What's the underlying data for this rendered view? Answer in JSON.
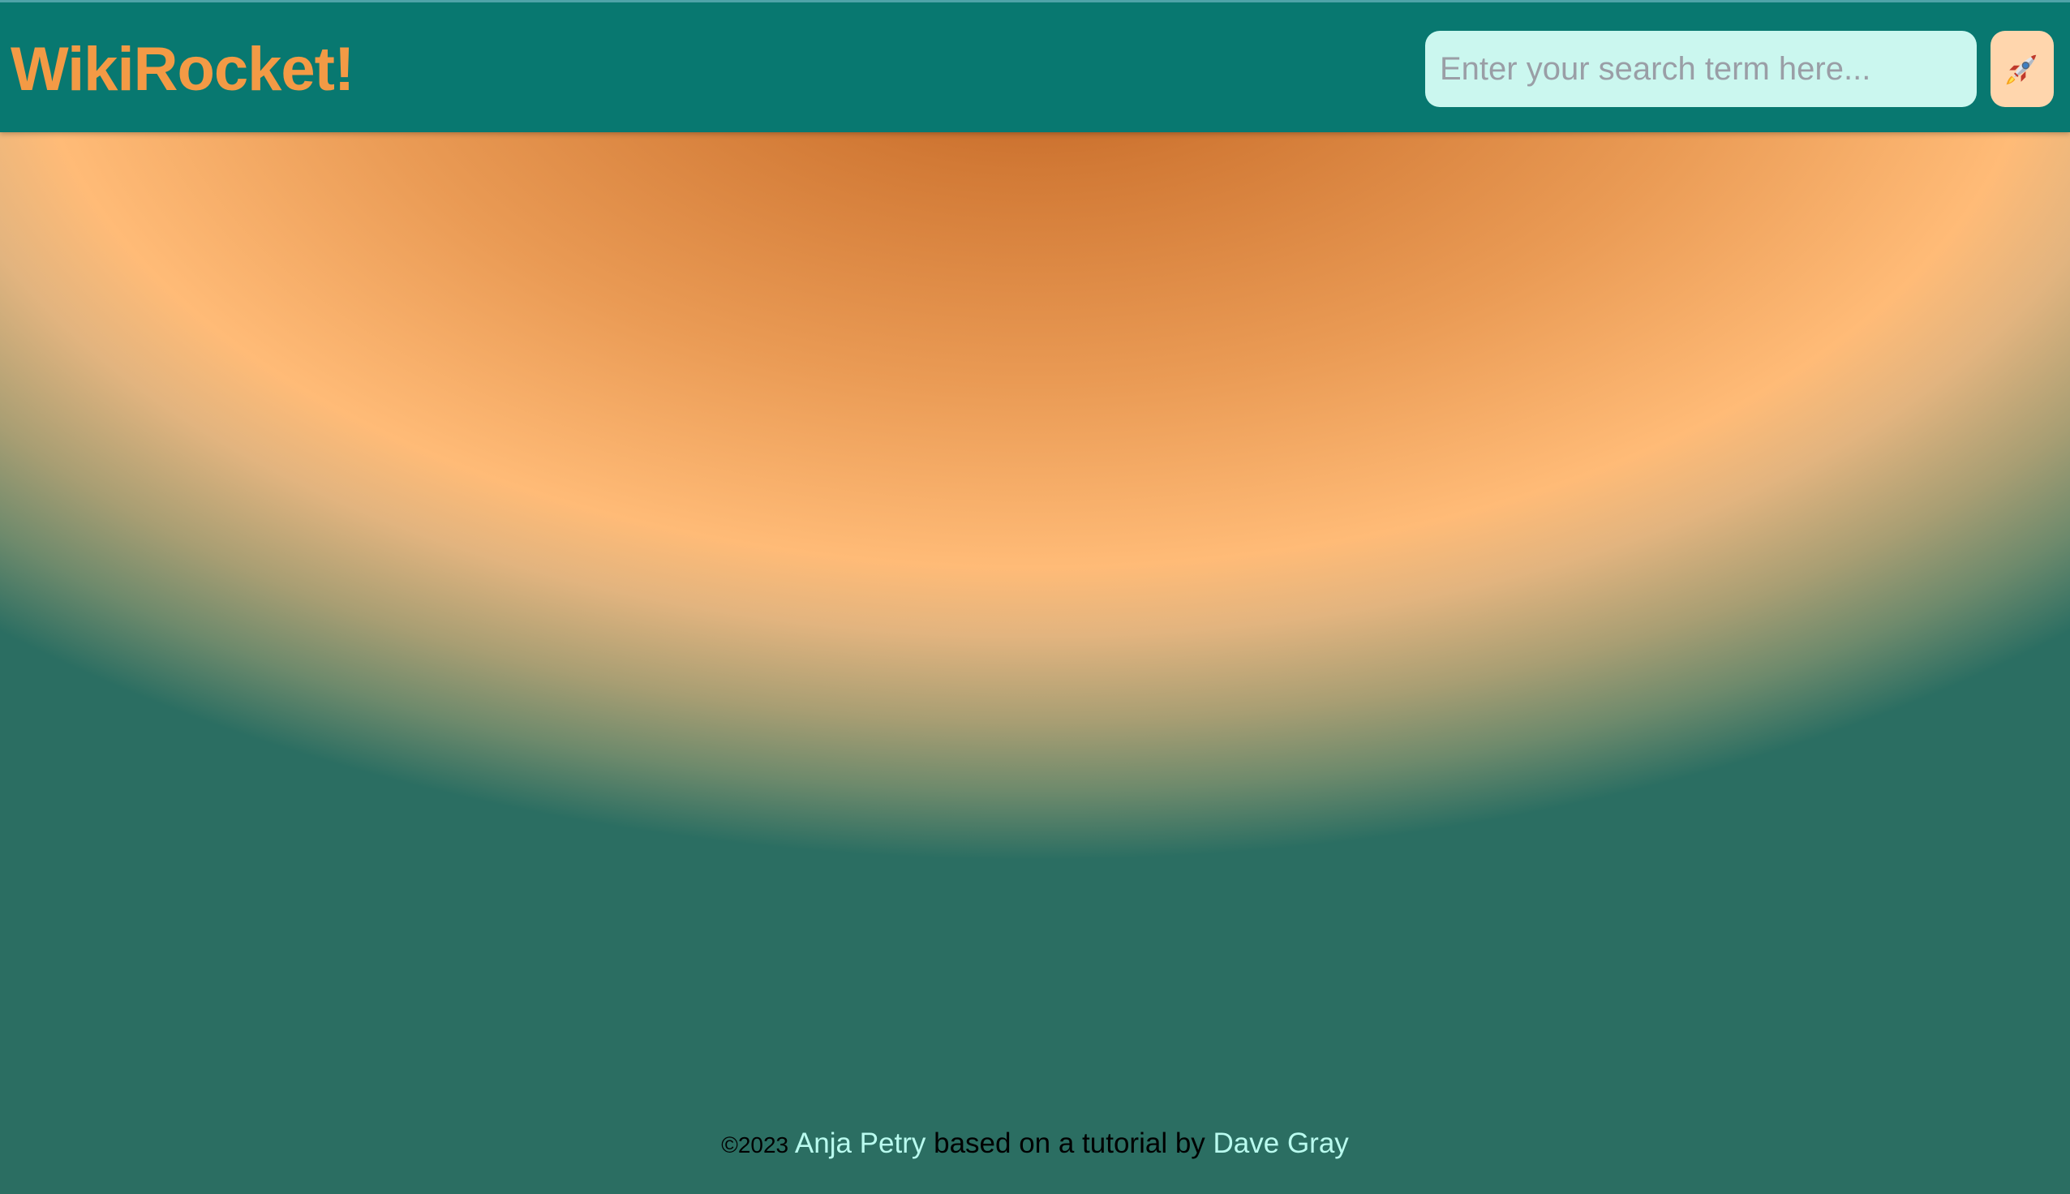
{
  "header": {
    "title": "WikiRocket!",
    "search": {
      "placeholder": "Enter your search term here...",
      "value": ""
    },
    "submit_icon": "rocket-icon"
  },
  "footer": {
    "copyright": "©2023",
    "author_link": "Anja Petry",
    "middle_text": "based on a tutorial by",
    "tutorial_link": "Dave Gray"
  },
  "colors": {
    "header_bg": "#087870",
    "brand": "#f39a45",
    "search_bg": "#cbf7ef",
    "button_bg": "#ffd6ad",
    "link": "#b9fbef"
  }
}
